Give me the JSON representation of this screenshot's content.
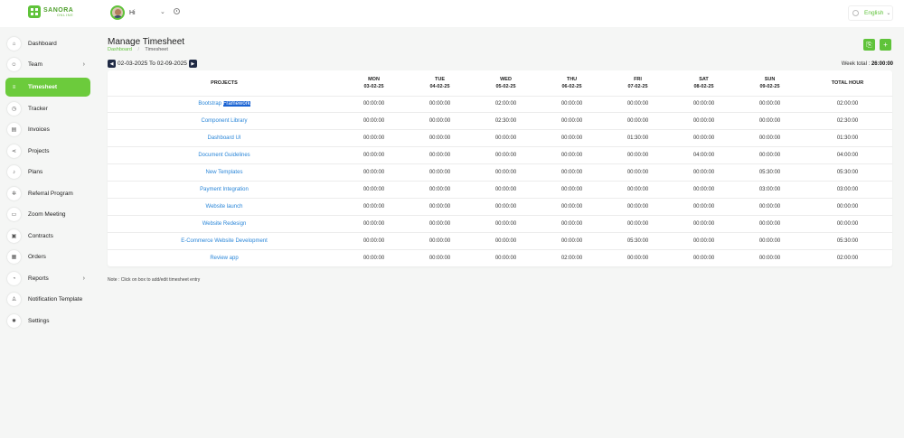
{
  "brand": {
    "name": "SANORA",
    "sub": "ONLINE"
  },
  "header": {
    "greeting": "Hi",
    "language": "English",
    "colors": {
      "accent": "#5fc33a",
      "active_nav": "#6ccb3c",
      "link": "#2a86d8"
    }
  },
  "sidebar": {
    "items": [
      {
        "label": "Dashboard",
        "icon": "home-icon",
        "glyph": "⌂"
      },
      {
        "label": "Team",
        "icon": "users-icon",
        "glyph": "☺",
        "chevron": "›"
      },
      {
        "label": "Timesheet",
        "icon": "list-icon",
        "glyph": "≡",
        "active": true
      },
      {
        "label": "Tracker",
        "icon": "clock-icon",
        "glyph": "◷"
      },
      {
        "label": "Invoices",
        "icon": "file-icon",
        "glyph": "▤"
      },
      {
        "label": "Projects",
        "icon": "share-icon",
        "glyph": "⋖"
      },
      {
        "label": "Plans",
        "icon": "bell-icon",
        "glyph": "♪"
      },
      {
        "label": "Referral Program",
        "icon": "gear-icon",
        "glyph": "✲"
      },
      {
        "label": "Zoom Meeting",
        "icon": "video-icon",
        "glyph": "▭"
      },
      {
        "label": "Contracts",
        "icon": "document-icon",
        "glyph": "▣"
      },
      {
        "label": "Orders",
        "icon": "grid-icon",
        "glyph": "▦"
      },
      {
        "label": "Reports",
        "icon": "chart-icon",
        "glyph": "◔",
        "chevron": "›"
      },
      {
        "label": "Notification Template",
        "icon": "user-icon",
        "glyph": "♙"
      },
      {
        "label": "Settings",
        "icon": "settings-icon",
        "glyph": "✹"
      }
    ]
  },
  "page": {
    "title": "Manage Timesheet",
    "breadcrumb": {
      "home": "Dashboard",
      "sep": "/",
      "current": "Timesheet"
    },
    "buttons": {
      "export": "⎘",
      "add": "+"
    },
    "date_range": "02-03-2025 To 02-09-2025",
    "prev": "◀",
    "next": "▶",
    "week_total_label": "Week total :",
    "week_total_value": "26:00:00",
    "note": "Note : Click on box to add/edit timesheet entry"
  },
  "table": {
    "project_header": "PROJECTS",
    "total_header": "TOTAL HOUR",
    "days": [
      {
        "day": "MON",
        "date": "03-02-25"
      },
      {
        "day": "TUE",
        "date": "04-02-25"
      },
      {
        "day": "WED",
        "date": "05-02-25"
      },
      {
        "day": "THU",
        "date": "06-02-25"
      },
      {
        "day": "FRI",
        "date": "07-02-25"
      },
      {
        "day": "SAT",
        "date": "08-02-25"
      },
      {
        "day": "SUN",
        "date": "09-02-25"
      }
    ],
    "rows": [
      {
        "project": "Bootstrap Framework",
        "hours": [
          "00:00:00",
          "00:00:00",
          "02:00:00",
          "00:00:00",
          "00:00:00",
          "00:00:00",
          "00:00:00"
        ],
        "total": "02:00:00"
      },
      {
        "project": "Component Library",
        "hours": [
          "00:00:00",
          "00:00:00",
          "02:30:00",
          "00:00:00",
          "00:00:00",
          "00:00:00",
          "00:00:00"
        ],
        "total": "02:30:00"
      },
      {
        "project": "Dashboard UI",
        "hours": [
          "00:00:00",
          "00:00:00",
          "00:00:00",
          "00:00:00",
          "01:30:00",
          "00:00:00",
          "00:00:00"
        ],
        "total": "01:30:00"
      },
      {
        "project": "Document Guidelines",
        "hours": [
          "00:00:00",
          "00:00:00",
          "00:00:00",
          "00:00:00",
          "00:00:00",
          "04:00:00",
          "00:00:00"
        ],
        "total": "04:00:00"
      },
      {
        "project": "New Templates",
        "hours": [
          "00:00:00",
          "00:00:00",
          "00:00:00",
          "00:00:00",
          "00:00:00",
          "00:00:00",
          "05:30:00"
        ],
        "total": "05:30:00"
      },
      {
        "project": "Payment Integration",
        "hours": [
          "00:00:00",
          "00:00:00",
          "00:00:00",
          "00:00:00",
          "00:00:00",
          "00:00:00",
          "03:00:00"
        ],
        "total": "03:00:00"
      },
      {
        "project": "Website launch",
        "hours": [
          "00:00:00",
          "00:00:00",
          "00:00:00",
          "00:00:00",
          "00:00:00",
          "00:00:00",
          "00:00:00"
        ],
        "total": "00:00:00"
      },
      {
        "project": "Website Redesign",
        "hours": [
          "00:00:00",
          "00:00:00",
          "00:00:00",
          "00:00:00",
          "00:00:00",
          "00:00:00",
          "00:00:00"
        ],
        "total": "00:00:00"
      },
      {
        "project": "E-Commerce Website Development",
        "hours": [
          "00:00:00",
          "00:00:00",
          "00:00:00",
          "00:00:00",
          "05:30:00",
          "00:00:00",
          "00:00:00"
        ],
        "total": "05:30:00"
      },
      {
        "project": "Review app",
        "hours": [
          "00:00:00",
          "00:00:00",
          "00:00:00",
          "02:00:00",
          "00:00:00",
          "00:00:00",
          "00:00:00"
        ],
        "total": "02:00:00"
      }
    ]
  }
}
